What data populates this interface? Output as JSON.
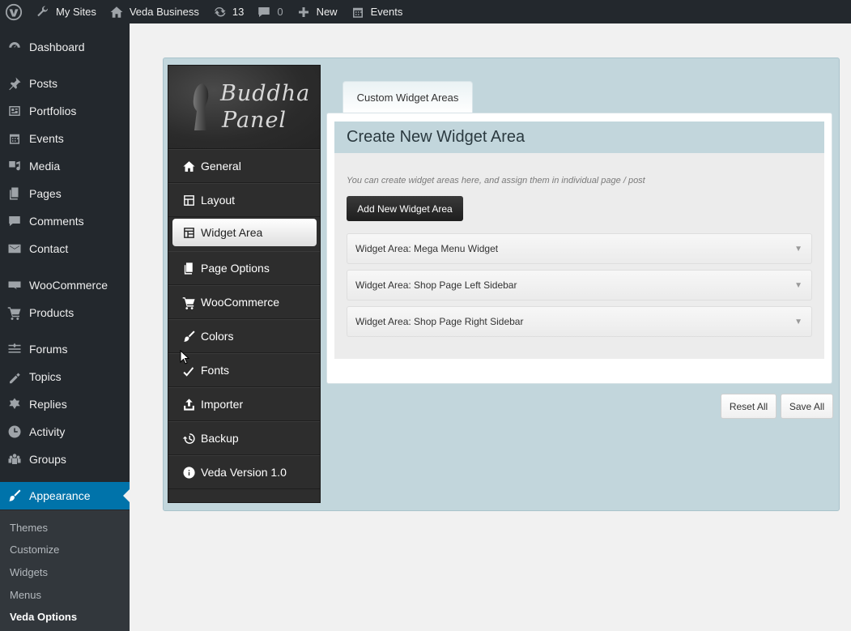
{
  "adminbar": {
    "my_sites": "My Sites",
    "site_name": "Veda Business",
    "updates_count": "13",
    "comments_count": "0",
    "new_label": "New",
    "events_label": "Events"
  },
  "menu": {
    "items": [
      {
        "label": "Dashboard",
        "icon": "dashboard-icon"
      },
      {
        "label": "Posts",
        "icon": "pin-icon"
      },
      {
        "label": "Portfolios",
        "icon": "portfolio-icon"
      },
      {
        "label": "Events",
        "icon": "calendar-icon"
      },
      {
        "label": "Media",
        "icon": "media-icon"
      },
      {
        "label": "Pages",
        "icon": "pages-icon"
      },
      {
        "label": "Comments",
        "icon": "comment-icon"
      },
      {
        "label": "Contact",
        "icon": "mail-icon"
      },
      {
        "label": "WooCommerce",
        "icon": "woo-icon"
      },
      {
        "label": "Products",
        "icon": "cart-icon"
      },
      {
        "label": "Forums",
        "icon": "forum-icon"
      },
      {
        "label": "Topics",
        "icon": "topics-icon"
      },
      {
        "label": "Replies",
        "icon": "replies-icon"
      },
      {
        "label": "Activity",
        "icon": "activity-icon"
      },
      {
        "label": "Groups",
        "icon": "groups-icon"
      },
      {
        "label": "Appearance",
        "icon": "brush-icon"
      }
    ],
    "submenu": [
      "Themes",
      "Customize",
      "Widgets",
      "Menus",
      "Veda Options"
    ]
  },
  "panel": {
    "logo_line1": "Buddha",
    "logo_line2": "Panel",
    "nav": [
      {
        "label": "General",
        "icon": "home-icon"
      },
      {
        "label": "Layout",
        "icon": "layout-icon"
      },
      {
        "label": "Widget Area",
        "icon": "widget-icon"
      },
      {
        "label": "Page Options",
        "icon": "page-options-icon"
      },
      {
        "label": "WooCommerce",
        "icon": "cart-icon"
      },
      {
        "label": "Colors",
        "icon": "brush-icon"
      },
      {
        "label": "Fonts",
        "icon": "fonts-icon"
      },
      {
        "label": "Importer",
        "icon": "import-icon"
      },
      {
        "label": "Backup",
        "icon": "backup-icon"
      },
      {
        "label": "Veda Version 1.0",
        "icon": "info-icon"
      }
    ],
    "active_nav": "Widget Area"
  },
  "content": {
    "tab_label": "Custom Widget Areas",
    "section_title": "Create New Widget Area",
    "help_text": "You can create widget areas here, and assign them in individual page / post",
    "add_button": "Add New Widget Area",
    "widget_areas": [
      "Widget Area: Mega Menu Widget",
      "Widget Area: Shop Page Left Sidebar",
      "Widget Area: Shop Page Right Sidebar"
    ],
    "reset_button": "Reset All",
    "save_button": "Save All"
  },
  "colors": {
    "admin_dark": "#23282d",
    "accent_blue": "#0073aa",
    "panel_bg": "#c2d6dc"
  }
}
